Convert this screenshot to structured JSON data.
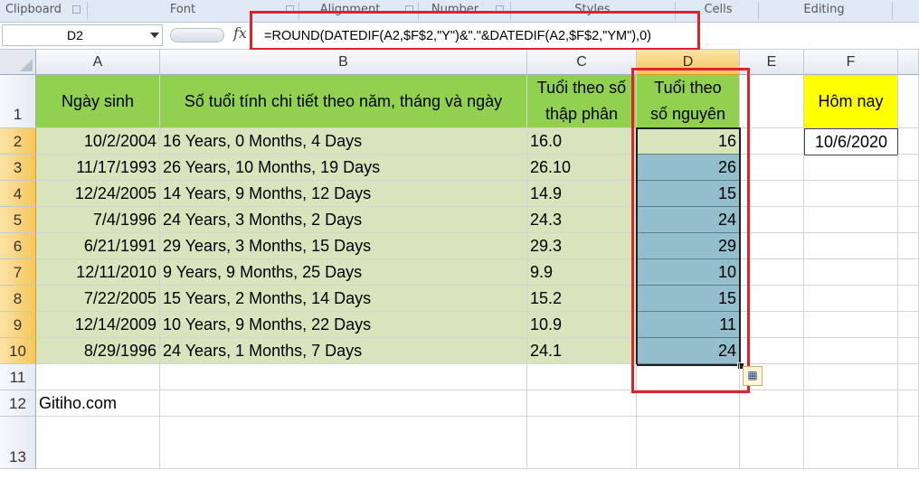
{
  "ribbon": {
    "groups": [
      "Clipboard",
      "Font",
      "Alignment",
      "Number",
      "Styles",
      "Cells",
      "Editing"
    ]
  },
  "formula_bar": {
    "name_box": "D2",
    "fx_icon": "fx-icon",
    "formula": "=ROUND(DATEDIF(A2,$F$2,\"Y\")&\".\"&DATEDIF(A2,$F$2,\"YM\"),0)"
  },
  "columns": [
    "A",
    "B",
    "C",
    "D",
    "E",
    "F"
  ],
  "rows": [
    "1",
    "2",
    "3",
    "4",
    "5",
    "6",
    "7",
    "8",
    "9",
    "10",
    "11",
    "12",
    "13"
  ],
  "headers": {
    "a": "Ngày sinh",
    "b": "Số tuổi tính chi tiết theo năm, tháng và ngày",
    "c_line1": "Tuổi theo số",
    "c_line2": "thập phân",
    "d_line1": "Tuổi theo",
    "d_line2": "số nguyên",
    "f": "Hôm nay"
  },
  "today_value": "10/6/2020",
  "data_rows": [
    {
      "a": "10/2/2004",
      "b": "16 Years, 0 Months, 4 Days",
      "c": "16.0",
      "d": "16"
    },
    {
      "a": "11/17/1993",
      "b": "26 Years, 10 Months, 19 Days",
      "c": "26.10",
      "d": "26"
    },
    {
      "a": "12/24/2005",
      "b": "14 Years, 9 Months, 12 Days",
      "c": "14.9",
      "d": "15"
    },
    {
      "a": "7/4/1996",
      "b": "24 Years, 3 Months, 2 Days",
      "c": "24.3",
      "d": "24"
    },
    {
      "a": "6/21/1991",
      "b": "29 Years, 3 Months, 15 Days",
      "c": "29.3",
      "d": "29"
    },
    {
      "a": "12/11/2010",
      "b": "9 Years, 9 Months, 25 Days",
      "c": "9.9",
      "d": "10"
    },
    {
      "a": "7/22/2005",
      "b": "15 Years, 2 Months, 14 Days",
      "c": "15.2",
      "d": "15"
    },
    {
      "a": "12/14/2009",
      "b": "10 Years, 9 Months, 22 Days",
      "c": "10.9",
      "d": "11"
    },
    {
      "a": "8/29/1996",
      "b": "24 Years, 1 Months, 7 Days",
      "c": "24.1",
      "d": "24"
    }
  ],
  "footer_text": "Gitiho.com",
  "colors": {
    "header_green": "#92d050",
    "data_green": "#d8e4bc",
    "teal_selection": "#92bfcb",
    "today_yellow": "#ffff00",
    "highlight_red": "#e0232a"
  }
}
